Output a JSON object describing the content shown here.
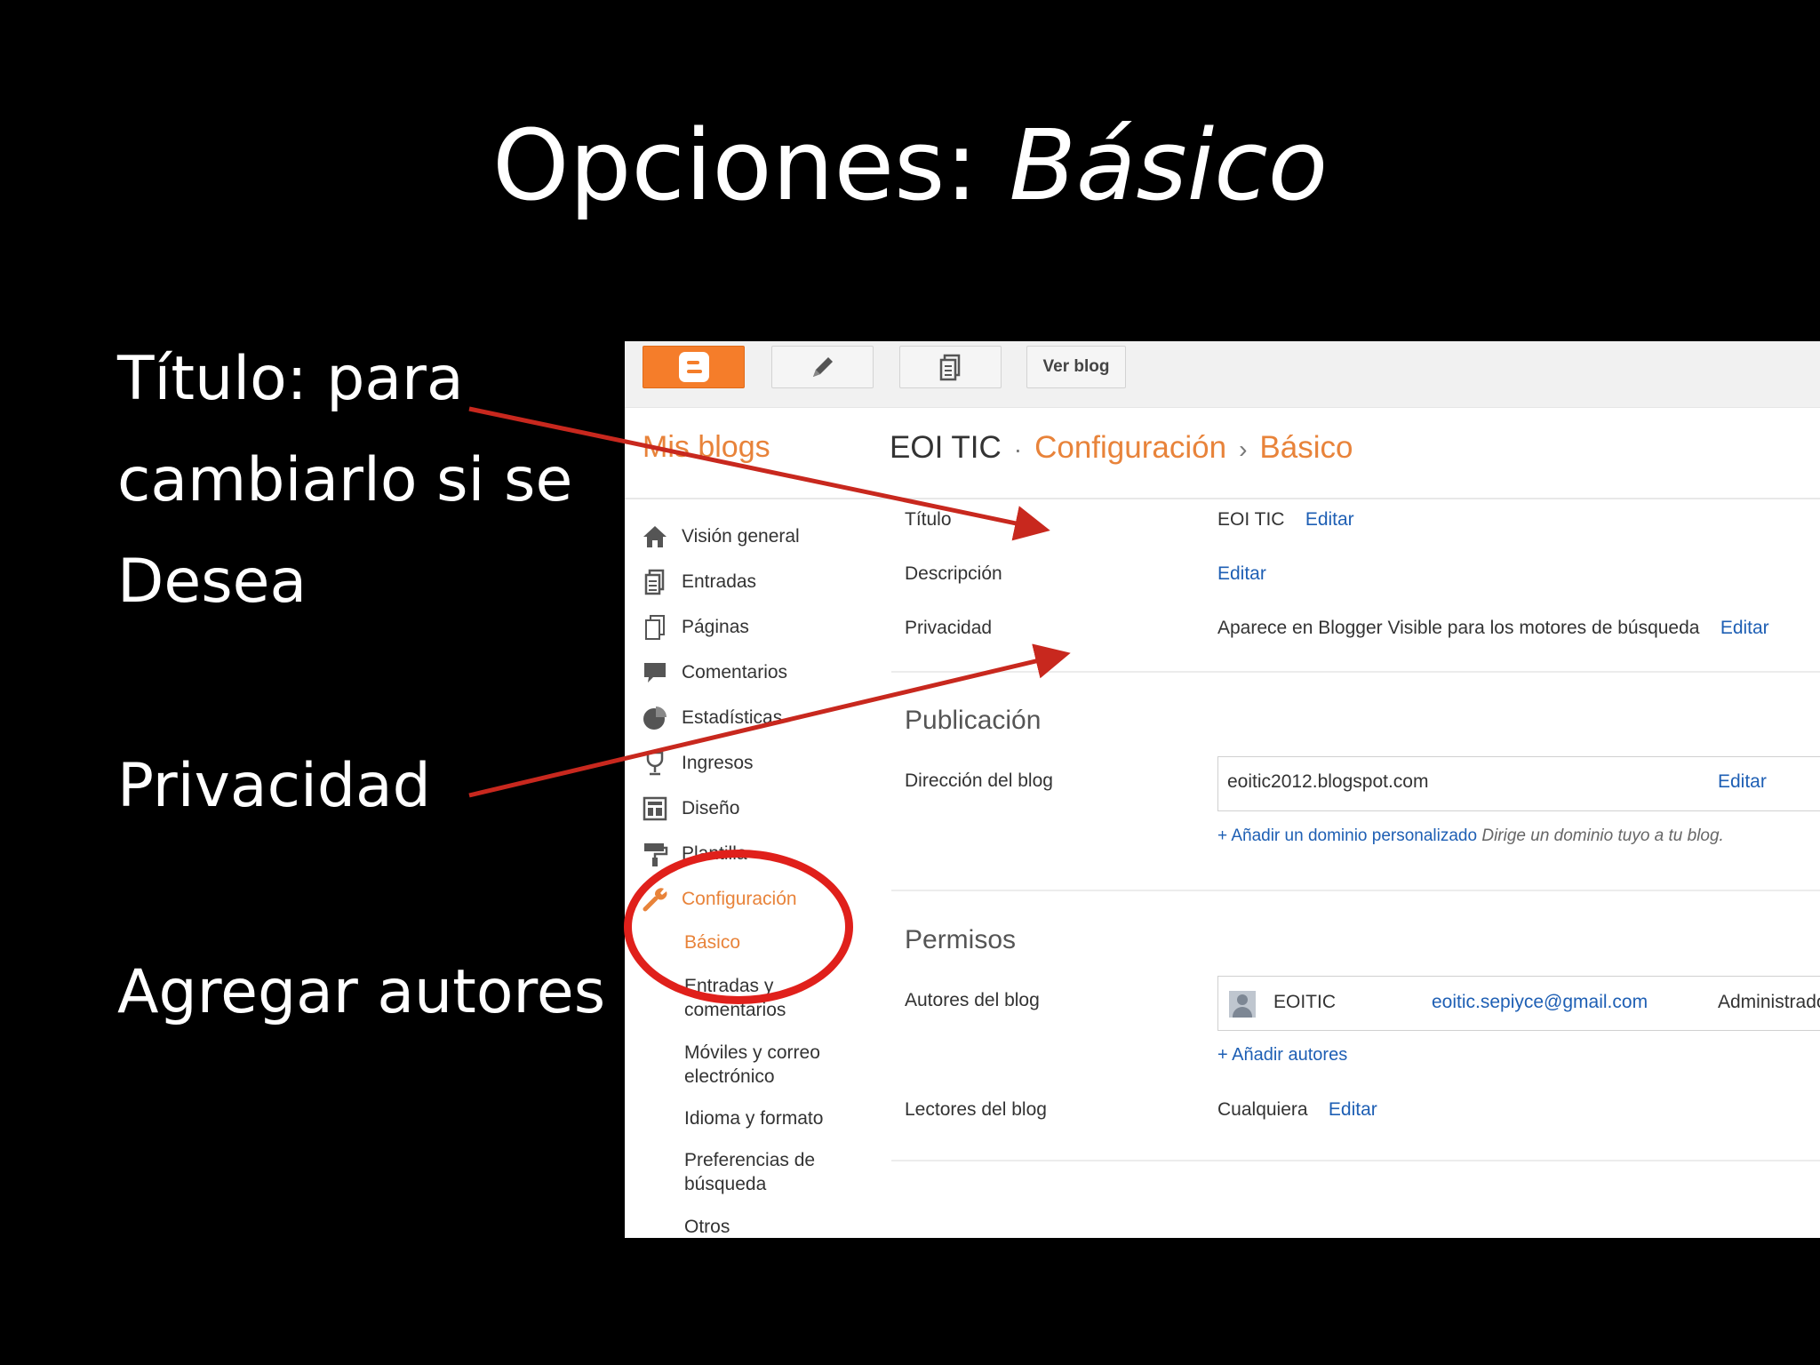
{
  "slide": {
    "title_prefix": "Opciones: ",
    "title_italic": "Básico",
    "bullets": [
      {
        "line1": "Título: para",
        "line2": "cambiarlo si se",
        "line3": "Desea"
      },
      {
        "line1": "Privacidad"
      },
      {
        "line1": "Agregar autores"
      }
    ]
  },
  "toolbar": {
    "blogger_icon": "blogger-logo-icon",
    "pencil_icon": "pencil-icon",
    "pages_icon": "pages-icon",
    "ver_blog_label": "Ver blog"
  },
  "header": {
    "mis_blogs": "Mis blogs",
    "blog_name": "EOI TIC",
    "sep1": "·",
    "section": "Configuración",
    "sep2": "›",
    "page": "Básico"
  },
  "sidebar": {
    "items": [
      {
        "label": "Visión general",
        "icon": "home-icon"
      },
      {
        "label": "Entradas",
        "icon": "posts-icon"
      },
      {
        "label": "Páginas",
        "icon": "pages-icon"
      },
      {
        "label": "Comentarios",
        "icon": "comment-icon"
      },
      {
        "label": "Estadísticas",
        "icon": "stats-icon"
      },
      {
        "label": "Ingresos",
        "icon": "earnings-icon"
      },
      {
        "label": "Diseño",
        "icon": "layout-icon"
      },
      {
        "label": "Plantilla",
        "icon": "template-icon"
      },
      {
        "label": "Configuración",
        "icon": "wrench-icon"
      }
    ],
    "sub_items": [
      {
        "label": "Básico"
      },
      {
        "label": "Entradas y comentarios"
      },
      {
        "label": "Móviles y correo electrónico"
      },
      {
        "label": "Idioma y formato"
      },
      {
        "label": "Preferencias de búsqueda"
      },
      {
        "label": "Otros"
      }
    ]
  },
  "basic": {
    "titulo_label": "Título",
    "titulo_value": "EOI TIC",
    "titulo_edit": "Editar",
    "descripcion_label": "Descripción",
    "descripcion_edit": "Editar",
    "privacidad_label": "Privacidad",
    "privacidad_value": "Aparece en Blogger Visible para los motores de búsqueda",
    "privacidad_edit": "Editar"
  },
  "publicacion": {
    "title": "Publicación",
    "direccion_label": "Dirección del blog",
    "direccion_value": "eoitic2012.blogspot.com",
    "direccion_edit": "Editar",
    "add_domain_link": "+ Añadir un dominio personalizado",
    "add_domain_hint": "Dirige un dominio tuyo a tu blog."
  },
  "permisos": {
    "title": "Permisos",
    "autores_label": "Autores del blog",
    "author_name": "EOITIC",
    "author_email": "eoitic.sepiyce@gmail.com",
    "author_role": "Administrador",
    "add_authors": "+ Añadir autores",
    "lectores_label": "Lectores del blog",
    "lectores_value": "Cualquiera",
    "lectores_edit": "Editar"
  },
  "annotation_color": "#c8281e"
}
